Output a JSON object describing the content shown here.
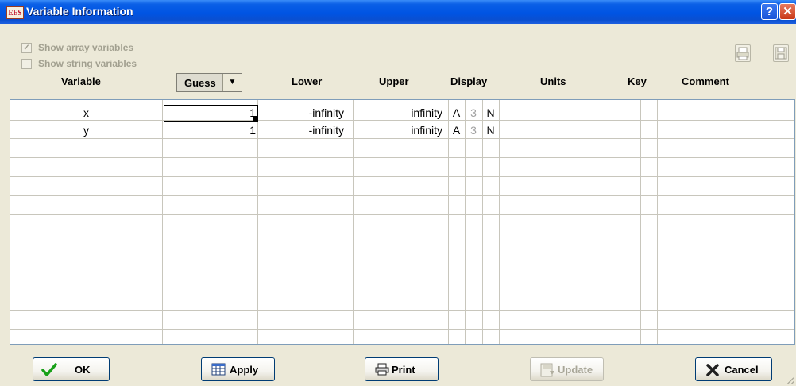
{
  "window": {
    "title": "Variable Information",
    "app_icon": "EES"
  },
  "options": {
    "show_array_variables": {
      "label": "Show array variables",
      "checked": true,
      "enabled": false
    },
    "show_string_variables": {
      "label": "Show string variables",
      "checked": false,
      "enabled": false
    }
  },
  "columns": {
    "variable": "Variable",
    "guess": "Guess",
    "lower": "Lower",
    "upper": "Upper",
    "display": "Display",
    "units": "Units",
    "key": "Key",
    "comment": "Comment"
  },
  "rows": [
    {
      "variable": "x",
      "guess": "1",
      "lower": "-infinity",
      "upper": "infinity",
      "display": [
        "A",
        "3",
        "N"
      ],
      "units": "",
      "key": "",
      "comment": ""
    },
    {
      "variable": "y",
      "guess": "1",
      "lower": "-infinity",
      "upper": "infinity",
      "display": [
        "A",
        "3",
        "N"
      ],
      "units": "",
      "key": "",
      "comment": ""
    }
  ],
  "buttons": {
    "ok": "OK",
    "apply": "Apply",
    "print": "Print",
    "update": "Update",
    "cancel": "Cancel"
  },
  "icons": [
    "help-icon",
    "close-icon",
    "print-icon",
    "save-icon",
    "checkmark-icon",
    "table-icon",
    "printer-icon",
    "update-icon",
    "x-icon",
    "dropdown-arrow-icon"
  ],
  "colors": {
    "titlebar": "#0054e3",
    "dialog_bg": "#ece9d8",
    "ok_check": "#18a018",
    "cancel_x": "#202020"
  }
}
